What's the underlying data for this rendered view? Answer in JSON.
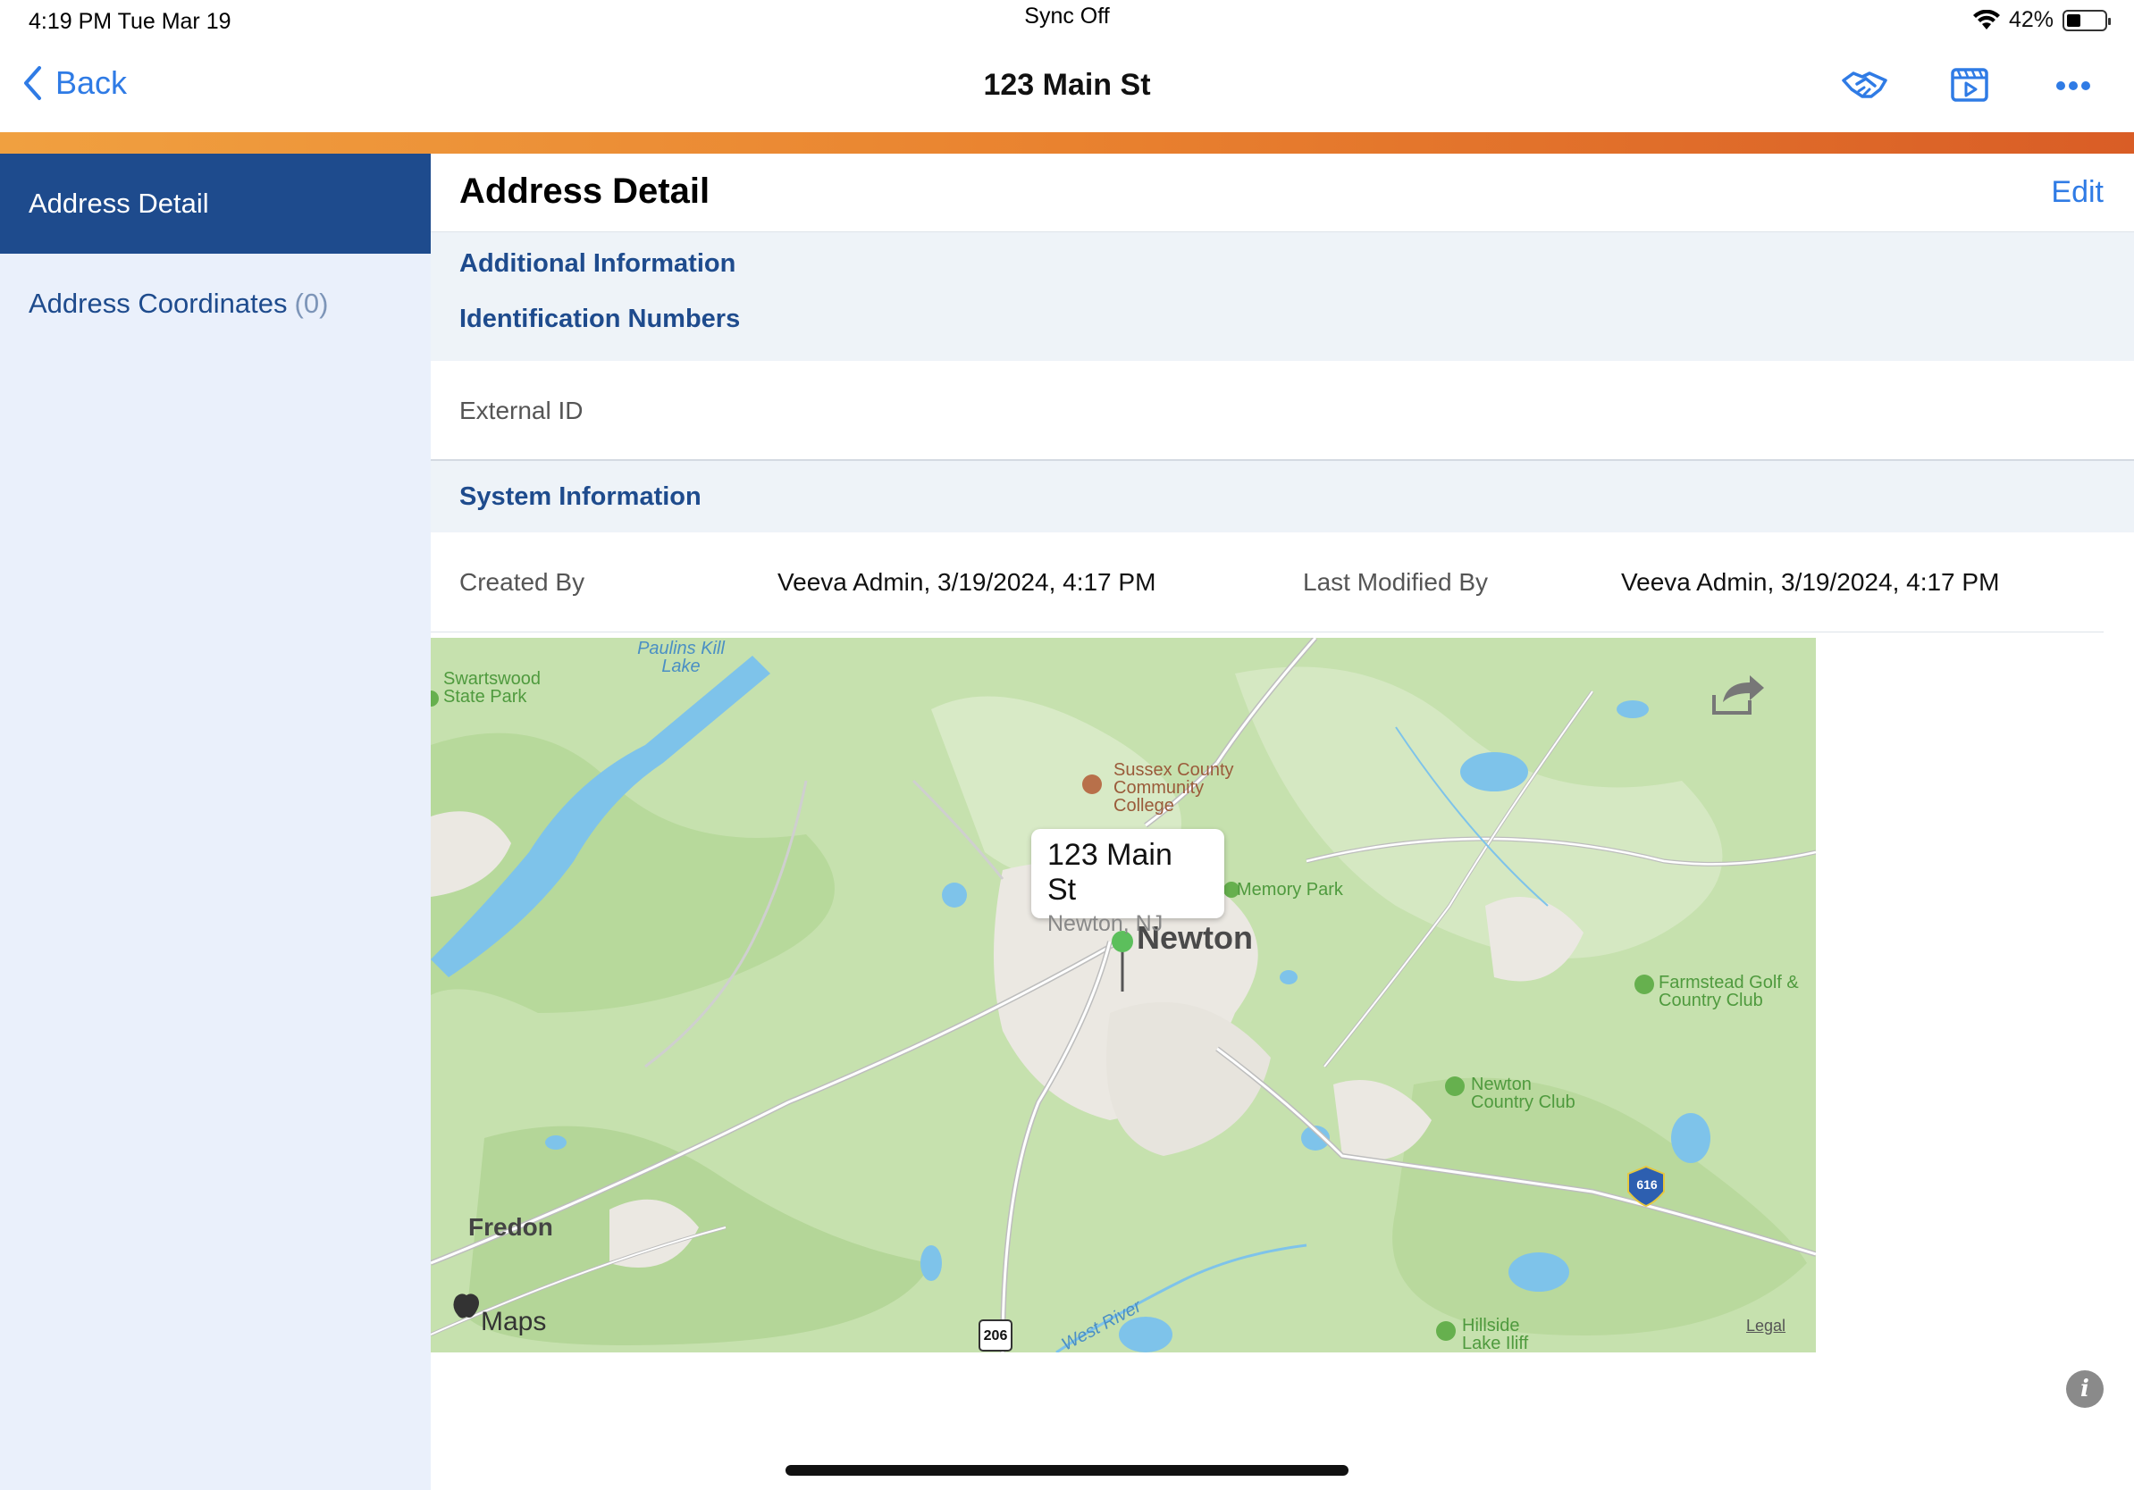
{
  "status_bar": {
    "time": "4:19 PM   Tue Mar 19",
    "center": "Sync Off",
    "battery": "42%"
  },
  "nav": {
    "back_label": "Back",
    "title": "123 Main St"
  },
  "sidebar": {
    "items": [
      {
        "label": "Address Detail",
        "active": true
      },
      {
        "label": "Address Coordinates",
        "count": "(0)"
      }
    ]
  },
  "main": {
    "title": "Address Detail",
    "edit_label": "Edit",
    "sections": {
      "additional_information": "Additional Information",
      "identification_numbers": "Identification Numbers",
      "system_information": "System Information"
    },
    "external_id_label": "External ID",
    "created_by_label": "Created By",
    "created_by_value": "Veeva Admin, 3/19/2024, 4:17 PM",
    "last_modified_label": "Last Modified By",
    "last_modified_value": "Veeva Admin, 3/19/2024, 4:17 PM"
  },
  "map": {
    "callout_title": "123 Main St",
    "callout_subtitle": "Newton, NJ",
    "labels": {
      "paulins": "Paulins Kill Lake",
      "swartswood": "Swartswood State Park",
      "college": "Sussex County Community College",
      "memory_park": "Memory Park",
      "newton": "Newton",
      "farmstead": "Farmstead Golf & Country Club",
      "newton_cc": "Newton Country Club",
      "fredon": "Fredon",
      "route_616": "616",
      "route_206": "206",
      "west_river": "West River",
      "hillside": "Hillside Lake Iliff",
      "maps_brand": "Maps",
      "legal": "Legal"
    }
  },
  "colors": {
    "accent": "#2f7be5",
    "navy": "#1e4b8d",
    "stripe_start": "#f0a040",
    "stripe_end": "#d95d26"
  }
}
